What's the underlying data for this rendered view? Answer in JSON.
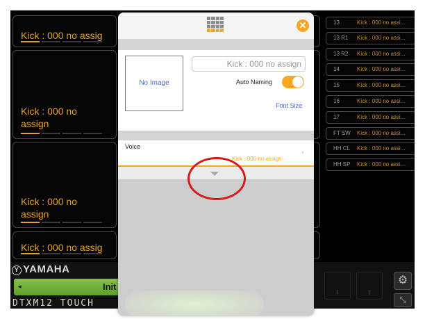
{
  "pads": [
    {
      "label": "Kick : 000 no assig"
    },
    {
      "label": "Kick : 000 no assign"
    },
    {
      "label": "Kick : 000 no assign"
    },
    {
      "label": "Kick : 000 no assig"
    }
  ],
  "right_list": [
    {
      "num": "13",
      "value": "Kick : 000 no assi..."
    },
    {
      "num": "13 R1",
      "value": "Kick : 000 no assi..."
    },
    {
      "num": "13 R2",
      "value": "Kick : 000 no assi..."
    },
    {
      "num": "14",
      "value": "Kick : 000 no assi..."
    },
    {
      "num": "15",
      "value": "Kick : 000 no assi..."
    },
    {
      "num": "16",
      "value": "Kick : 000 no assi..."
    },
    {
      "num": "17",
      "value": "Kick : 000 no assi..."
    },
    {
      "num": "FT SW",
      "value": "Kick : 000 no assi..."
    },
    {
      "num": "HH CL",
      "value": "Kick : 000 no assi..."
    },
    {
      "num": "HH SP",
      "value": "Kick : 000 no assi..."
    }
  ],
  "bottom": {
    "brand": "YAMAHA",
    "brand_mark": "Y",
    "kit_name": "Init Ki",
    "kit_arrow": "◂",
    "product": "DTXM12 TOUCH",
    "gear_icon": "⚙",
    "expand_icon": "⤡",
    "down_arrow": "⬇",
    "up_arrow": "⬆"
  },
  "dialog": {
    "close_icon": "✕",
    "image_placeholder": "No Image",
    "name_field": "Kick : 000 no assign",
    "auto_naming_label": "Auto Naming",
    "auto_naming_on": true,
    "font_size_link": "Font Size",
    "voice_label": "Voice",
    "voice_value": "Kick : 000 no assign",
    "voice_chevron": "›"
  },
  "colors": {
    "accent": "#f5a623",
    "pad_text": "#e8a21e",
    "kit_bar": "#7ab83e",
    "highlight_circle": "#d8191b"
  }
}
